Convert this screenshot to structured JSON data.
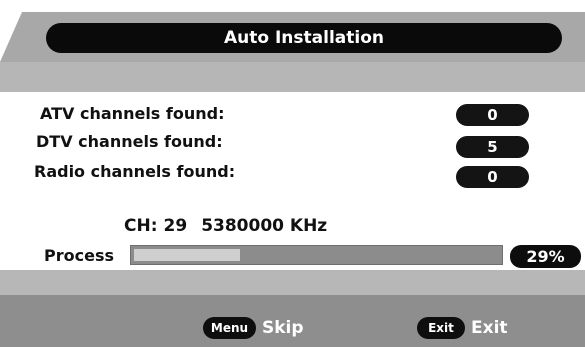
{
  "title": "Auto Installation",
  "rows": [
    {
      "label": "ATV channels found:",
      "count": "0"
    },
    {
      "label": "DTV channels found:",
      "count": "5"
    },
    {
      "label": "Radio channels found:",
      "count": "0"
    }
  ],
  "channel": {
    "prefix": "CH:",
    "number": "29",
    "frequency": "5380000 KHz"
  },
  "process": {
    "label": "Process",
    "percent_text": "29%",
    "fraction": 0.29
  },
  "footer": {
    "skip": {
      "key": "Menu",
      "label": "Skip"
    },
    "exit": {
      "key": "Exit",
      "label": "Exit"
    }
  },
  "colors": {
    "pill": "#0a0a0a",
    "band": "#b6b6b6",
    "footer": "#8e8e8e",
    "progress_fill": "#cfcfcf"
  }
}
